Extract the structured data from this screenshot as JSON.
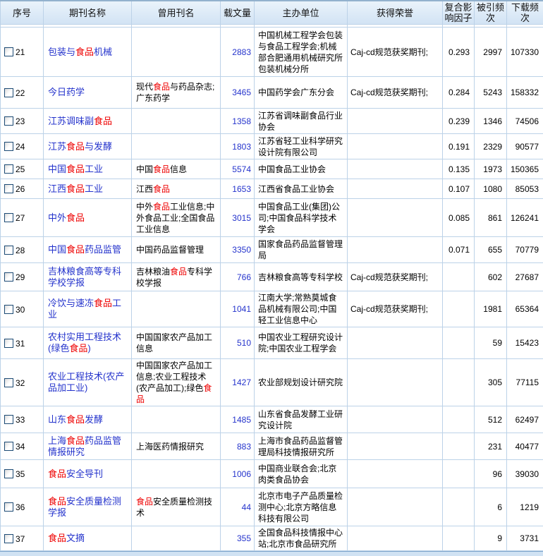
{
  "palette": {
    "link_blue": "#2433cc",
    "highlight_red": "#ee0000",
    "header_bg_top": "#eaf3fb",
    "header_bg_bottom": "#d2e3f4",
    "border": "#bcd2e8"
  },
  "table": {
    "headers": [
      "序号",
      "期刊名称",
      "曾用刊名",
      "载文量",
      "主办单位",
      "获得荣誉",
      "复合影响因子",
      "被引频次",
      "下载频次"
    ],
    "header_keys": [
      "seq",
      "journal-name",
      "former-name",
      "articles",
      "sponsor",
      "honors",
      "impact-factor",
      "cited-count",
      "download-count"
    ],
    "rows": [
      {
        "num": "21",
        "name": [
          [
            "包装与",
            0
          ],
          [
            "食品",
            1
          ],
          [
            "机械",
            0
          ]
        ],
        "former": [],
        "articles": "2883",
        "sponsor": "中国机械工程学会包装与食品工程学会;机械部合肥通用机械研究所包装机械分所",
        "honor": "Caj-cd规范获奖期刊;",
        "impact": "0.293",
        "cited": "2997",
        "downloads": "107330"
      },
      {
        "num": "22",
        "name": [
          [
            "今日药学",
            0
          ]
        ],
        "former": [
          [
            "现代",
            0
          ],
          [
            "食品",
            1
          ],
          [
            "与药品杂志;广东药学",
            0
          ]
        ],
        "articles": "3465",
        "sponsor": "中国药学会广东分会",
        "honor": "Caj-cd规范获奖期刊;",
        "impact": "0.284",
        "cited": "5243",
        "downloads": "158332"
      },
      {
        "num": "23",
        "name": [
          [
            "江苏调味副",
            0
          ],
          [
            "食品",
            1
          ]
        ],
        "former": [],
        "articles": "1358",
        "sponsor": "江苏省调味副食品行业协会",
        "honor": "",
        "impact": "0.239",
        "cited": "1346",
        "downloads": "74506"
      },
      {
        "num": "24",
        "name": [
          [
            "江苏",
            0
          ],
          [
            "食品",
            1
          ],
          [
            "与发酵",
            0
          ]
        ],
        "former": [],
        "articles": "1803",
        "sponsor": "江苏省轻工业科学研究设计院有限公司",
        "honor": "",
        "impact": "0.191",
        "cited": "2329",
        "downloads": "90577"
      },
      {
        "num": "25",
        "name": [
          [
            "中国",
            0
          ],
          [
            "食品",
            1
          ],
          [
            "工业",
            0
          ]
        ],
        "former": [
          [
            "中国",
            0
          ],
          [
            "食品",
            1
          ],
          [
            "信息",
            0
          ]
        ],
        "articles": "5574",
        "sponsor": "中国食品工业协会",
        "honor": "",
        "impact": "0.135",
        "cited": "1973",
        "downloads": "150365"
      },
      {
        "num": "26",
        "name": [
          [
            "江西",
            0
          ],
          [
            "食品",
            1
          ],
          [
            "工业",
            0
          ]
        ],
        "former": [
          [
            "江西",
            0
          ],
          [
            "食品",
            1
          ]
        ],
        "articles": "1653",
        "sponsor": "江西省食品工业协会",
        "honor": "",
        "impact": "0.107",
        "cited": "1080",
        "downloads": "85053"
      },
      {
        "num": "27",
        "name": [
          [
            "中外",
            0
          ],
          [
            "食品",
            1
          ]
        ],
        "former": [
          [
            "中外",
            0
          ],
          [
            "食品",
            1
          ],
          [
            "工业信息;中外食品工业;全国食品工业信息",
            0
          ]
        ],
        "articles": "3015",
        "sponsor": "中国食品工业(集团)公司;中国食品科学技术学会",
        "honor": "",
        "impact": "0.085",
        "cited": "861",
        "downloads": "126241"
      },
      {
        "num": "28",
        "name": [
          [
            "中国",
            0
          ],
          [
            "食品",
            1
          ],
          [
            "药品监管",
            0
          ]
        ],
        "former": [
          [
            "中国药品监督管理",
            0
          ]
        ],
        "articles": "3350",
        "sponsor": "国家食品药品监督管理局",
        "honor": "",
        "impact": "0.071",
        "cited": "655",
        "downloads": "70779"
      },
      {
        "num": "29",
        "name": [
          [
            "吉林粮食高等专科学校学报",
            0
          ]
        ],
        "former": [
          [
            "吉林粮油",
            0
          ],
          [
            "食品",
            1
          ],
          [
            "专科学校学报",
            0
          ]
        ],
        "articles": "766",
        "sponsor": "吉林粮食高等专科学校",
        "honor": "Caj-cd规范获奖期刊;",
        "impact": "",
        "cited": "602",
        "downloads": "27687"
      },
      {
        "num": "30",
        "name": [
          [
            "冷饮与速冻",
            0
          ],
          [
            "食品",
            1
          ],
          [
            "工业",
            0
          ]
        ],
        "former": [],
        "articles": "1041",
        "sponsor": "江南大学;常熟莫城食品机械有限公司;中国轻工业信息中心",
        "honor": "Caj-cd规范获奖期刊;",
        "impact": "",
        "cited": "1981",
        "downloads": "65364"
      },
      {
        "num": "31",
        "name": [
          [
            "农村实用工程技术(绿色",
            0
          ],
          [
            "食品",
            1
          ],
          [
            ")",
            0
          ]
        ],
        "former": [
          [
            "中国国家农产品加工信息",
            0
          ]
        ],
        "articles": "510",
        "sponsor": "中国农业工程研究设计院;中国农业工程学会",
        "honor": "",
        "impact": "",
        "cited": "59",
        "downloads": "15423"
      },
      {
        "num": "32",
        "name": [
          [
            "农业工程技术(农产品加工业)",
            0
          ]
        ],
        "former": [
          [
            "中国国家农产品加工信息;农业工程技术(农产品加工);绿色",
            0
          ],
          [
            "食品",
            1
          ]
        ],
        "articles": "1427",
        "sponsor": "农业部规划设计研究院",
        "honor": "",
        "impact": "",
        "cited": "305",
        "downloads": "77115"
      },
      {
        "num": "33",
        "name": [
          [
            "山东",
            0
          ],
          [
            "食品",
            1
          ],
          [
            "发酵",
            0
          ]
        ],
        "former": [],
        "articles": "1485",
        "sponsor": "山东省食品发酵工业研究设计院",
        "honor": "",
        "impact": "",
        "cited": "512",
        "downloads": "62497"
      },
      {
        "num": "34",
        "name": [
          [
            "上海",
            0
          ],
          [
            "食品",
            1
          ],
          [
            "药品监管情报研究",
            0
          ]
        ],
        "former": [
          [
            "上海医药情报研究",
            0
          ]
        ],
        "articles": "883",
        "sponsor": "上海市食品药品监督管理局科技情报研究所",
        "honor": "",
        "impact": "",
        "cited": "231",
        "downloads": "40477"
      },
      {
        "num": "35",
        "name": [
          [
            "食品",
            1
          ],
          [
            "安全导刊",
            0
          ]
        ],
        "former": [],
        "articles": "1006",
        "sponsor": "中国商业联合会;北京肉类食品协会",
        "honor": "",
        "impact": "",
        "cited": "96",
        "downloads": "39030"
      },
      {
        "num": "36",
        "name": [
          [
            "食品",
            1
          ],
          [
            "安全质量检测学报",
            0
          ]
        ],
        "former": [
          [
            "食品",
            1
          ],
          [
            "安全质量检测技术",
            0
          ]
        ],
        "articles": "44",
        "sponsor": "北京市电子产品质量检测中心;北京方略信息科技有限公司",
        "honor": "",
        "impact": "",
        "cited": "6",
        "downloads": "1219"
      },
      {
        "num": "37",
        "name": [
          [
            "食品",
            1
          ],
          [
            "文摘",
            0
          ]
        ],
        "former": [],
        "articles": "355",
        "sponsor": "全国食品科技情报中心站;北京市食品研究所",
        "honor": "",
        "impact": "",
        "cited": "9",
        "downloads": "3731"
      }
    ]
  }
}
